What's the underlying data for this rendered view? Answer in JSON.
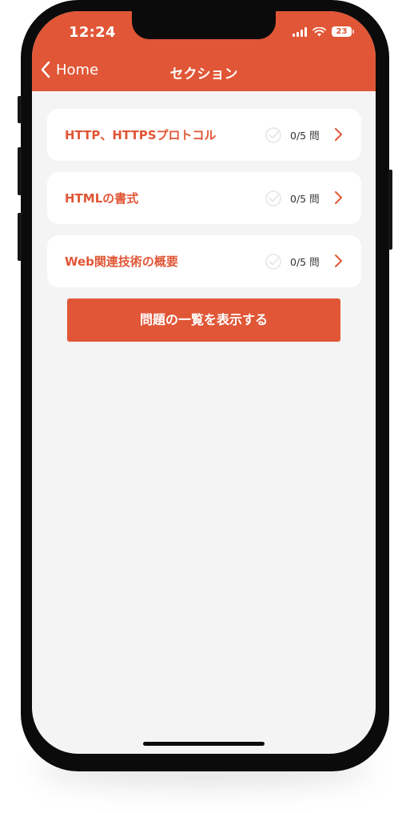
{
  "status_bar": {
    "time": "12:24",
    "battery": "23",
    "icons": [
      "signal-icon",
      "wifi-icon",
      "battery-icon"
    ]
  },
  "nav": {
    "back_label": "Home",
    "title": "セクション"
  },
  "sections": [
    {
      "title": "HTTP、HTTPSプロトコル",
      "progress": "0/5 問"
    },
    {
      "title": "HTMLの書式",
      "progress": "0/5 問"
    },
    {
      "title": "Web関連技術の概要",
      "progress": "0/5 問"
    }
  ],
  "primary_button": {
    "label": "問題の一覧を表示する"
  },
  "colors": {
    "accent": "#e05636",
    "background": "#f4f4f4",
    "card": "#ffffff"
  }
}
